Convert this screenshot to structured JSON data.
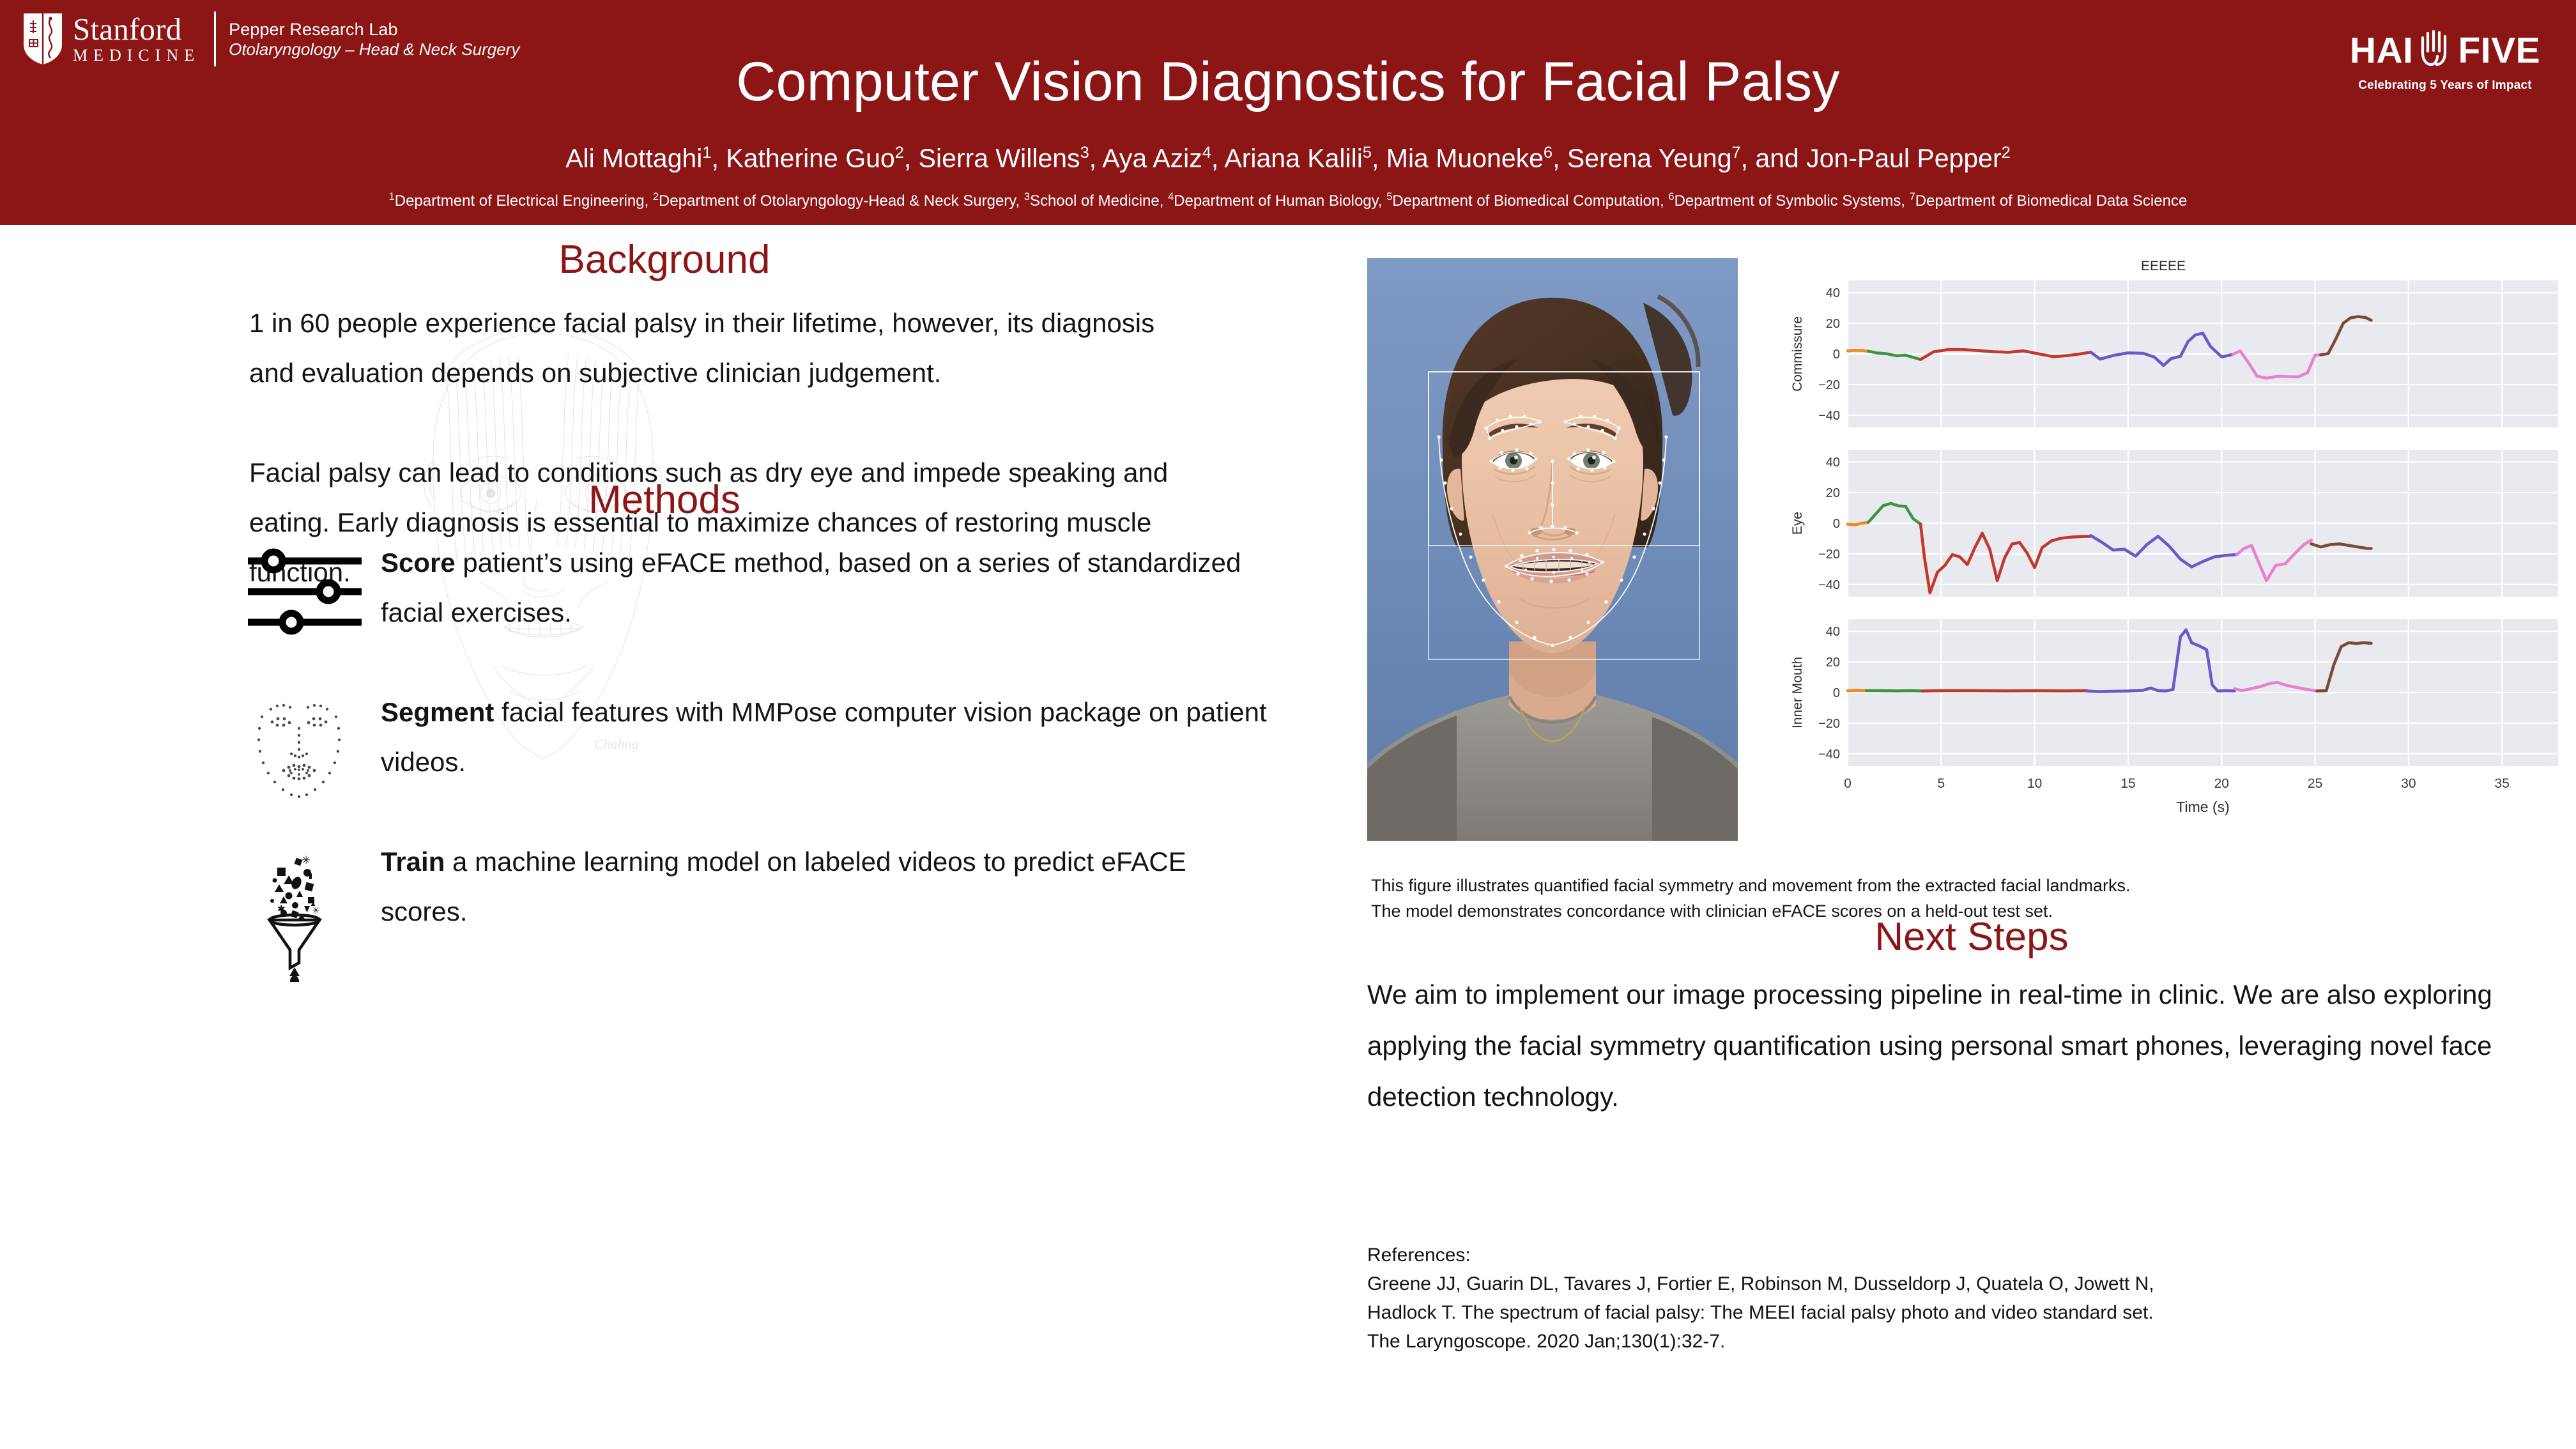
{
  "header": {
    "institution_name": "Stanford",
    "institution_sub": "MEDICINE",
    "lab_name": "Pepper Research Lab",
    "lab_dept": "Otolaryngology – Head & Neck Surgery",
    "title": "Computer Vision Diagnostics for Facial Palsy",
    "authors_html": "Ali Mottaghi<sup>1</sup>, Katherine Guo<sup>2</sup>, Sierra Willens<sup>3</sup>, Aya Aziz<sup>4</sup>, Ariana Kalili<sup>5</sup>, Mia Muoneke<sup>6</sup>, Serena Yeung<sup>7</sup>, and Jon-Paul Pepper<sup>2</sup>",
    "affiliations_html": "<sup>1</sup>Department of Electrical Engineering, <sup>2</sup>Department of Otolaryngology-Head &amp; Neck Surgery, <sup>3</sup>School of Medicine, <sup>4</sup>Department of Human Biology, <sup>5</sup>Department of Biomedical Computation, <sup>6</sup>Department of Symbolic Systems, <sup>7</sup>Department of Biomedical Data Science",
    "sponsor_logo_text": "HAI FIVE",
    "sponsor_logo_part1": "HAI",
    "sponsor_logo_part2": "FIVE",
    "sponsor_tagline": "Celebrating 5 Years of Impact",
    "brand_color": "#8c1515",
    "header_text_color": "#ffffff"
  },
  "background": {
    "heading": "Background",
    "paragraph_1": "1 in 60 people experience facial palsy in their lifetime, however, its diagnosis and evaluation depends on subjective clinician judgement.",
    "paragraph_2": "Facial palsy can lead to conditions such as dry eye and impede speaking and eating. Early diagnosis is essential to maximize chances of restoring muscle function."
  },
  "methods": {
    "heading": "Methods",
    "items": [
      {
        "icon": "sliders-icon",
        "lead": "Score",
        "rest": " patient’s using eFACE method, based on a series of standardized facial exercises."
      },
      {
        "icon": "facial-landmarks-icon",
        "lead": "Segment",
        "rest": " facial features with MMPose computer vision package on patient videos."
      },
      {
        "icon": "funnel-icon",
        "lead": "Train",
        "rest": " a machine learning model on labeled videos to predict eFACE scores."
      }
    ]
  },
  "figure": {
    "photo_alt": "patient-face-with-landmarks",
    "caption_line_1": "This figure illustrates quantified facial symmetry and movement from the extracted facial landmarks.",
    "caption_line_2": "The model demonstrates concordance with clinician eFACE scores on a held-out test set."
  },
  "next_steps": {
    "heading": "Next Steps",
    "paragraph": "We aim to implement our image processing pipeline in real-time in clinic. We are also exploring applying the facial symmetry quantification using personal smart phones, leveraging novel face detection technology."
  },
  "references": {
    "label": "References:",
    "line_1": "Greene JJ, Guarin DL, Tavares J, Fortier E, Robinson M, Dusseldorp J, Quatela O, Jowett N,",
    "line_2": "Hadlock T. The spectrum of facial palsy: The MEEI facial palsy photo and video standard set.",
    "line_3": "The Laryngoscope. 2020 Jan;130(1):32-7."
  },
  "chart_data": [
    {
      "type": "line",
      "title": "EEEEE",
      "ylabel": "Commissure",
      "xlabel": "",
      "xlim": [
        0,
        38
      ],
      "ylim": [
        -48,
        48
      ],
      "yticks": [
        -40,
        -20,
        0,
        20,
        40
      ],
      "xticks": [
        0,
        5,
        10,
        15,
        20,
        25,
        30,
        35
      ],
      "grid": true,
      "legend": "none",
      "series": [
        {
          "name": "segment-orange",
          "color": "#ee8c1f",
          "x": [
            0.0,
            0.4,
            0.8,
            1.1
          ],
          "y": [
            2.0,
            2.4,
            2.2,
            1.8
          ]
        },
        {
          "name": "segment-green",
          "color": "#3f9442",
          "x": [
            1.1,
            1.6,
            2.1,
            2.6,
            3.1,
            3.6,
            3.9
          ],
          "y": [
            1.8,
            0.6,
            0.1,
            -1.2,
            -0.8,
            -2.6,
            -3.6
          ]
        },
        {
          "name": "segment-red",
          "color": "#c2392b",
          "x": [
            3.9,
            4.6,
            5.4,
            6.2,
            7.0,
            7.8,
            8.6,
            9.4,
            10.2,
            11.0,
            11.8,
            12.6,
            13.0
          ],
          "y": [
            -3.6,
            1.4,
            2.9,
            2.8,
            2.2,
            1.4,
            1.1,
            2.0,
            0.1,
            -1.8,
            -1.0,
            0.3,
            1.2
          ]
        },
        {
          "name": "segment-purple",
          "color": "#6b58c9",
          "x": [
            13.0,
            13.5,
            14.2,
            15.0,
            15.8,
            16.4,
            16.9,
            17.3,
            17.8,
            18.2,
            18.6,
            19.0,
            19.4,
            20.0,
            20.6
          ],
          "y": [
            1.2,
            -3.4,
            -1.0,
            0.7,
            0.4,
            -2.0,
            -7.5,
            -3.0,
            -1.6,
            8.0,
            12.5,
            13.5,
            5.0,
            -1.9,
            -0.3
          ]
        },
        {
          "name": "segment-pink",
          "color": "#e87fd0",
          "x": [
            20.6,
            21.0,
            21.4,
            21.9,
            22.4,
            23.0,
            23.6,
            24.1,
            24.6,
            25.0,
            25.3
          ],
          "y": [
            -0.3,
            1.9,
            -5.0,
            -14.5,
            -15.8,
            -14.6,
            -14.8,
            -15.0,
            -12.2,
            -0.8,
            -0.6
          ]
        },
        {
          "name": "segment-brown",
          "color": "#7a4b30",
          "x": [
            25.3,
            25.7,
            26.1,
            26.5,
            26.9,
            27.3,
            27.7,
            28.0
          ],
          "y": [
            -0.6,
            0.2,
            9.5,
            20.0,
            23.6,
            24.4,
            23.8,
            22.0
          ]
        }
      ]
    },
    {
      "type": "line",
      "title": "",
      "ylabel": "Eye",
      "xlabel": "",
      "xlim": [
        0,
        38
      ],
      "ylim": [
        -48,
        48
      ],
      "yticks": [
        -40,
        -20,
        0,
        20,
        40
      ],
      "xticks": [
        0,
        5,
        10,
        15,
        20,
        25,
        30,
        35
      ],
      "grid": true,
      "legend": "none",
      "series": [
        {
          "name": "segment-orange",
          "color": "#ee8c1f",
          "x": [
            0.0,
            0.4,
            0.8,
            1.1
          ],
          "y": [
            -0.6,
            -1.0,
            0.1,
            0.6
          ]
        },
        {
          "name": "segment-green",
          "color": "#3f9442",
          "x": [
            1.1,
            1.5,
            1.9,
            2.3,
            2.7,
            3.1,
            3.5,
            3.9
          ],
          "y": [
            0.6,
            6.0,
            11.5,
            13.0,
            11.4,
            11.0,
            3.0,
            -0.6
          ]
        },
        {
          "name": "segment-red",
          "color": "#c2392b",
          "x": [
            3.9,
            4.1,
            4.4,
            4.8,
            5.2,
            5.6,
            6.0,
            6.4,
            6.8,
            7.2,
            7.6,
            8.0,
            8.4,
            8.8,
            9.2,
            9.6,
            10.0,
            10.4,
            10.9,
            11.4,
            12.0,
            12.6,
            13.0
          ],
          "y": [
            -0.5,
            -22.0,
            -45.5,
            -32.0,
            -27.5,
            -20.5,
            -22.0,
            -27.0,
            -16.0,
            -6.5,
            -17.0,
            -37.5,
            -22.5,
            -13.5,
            -12.6,
            -19.5,
            -29.0,
            -16.0,
            -11.5,
            -9.8,
            -9.0,
            -8.6,
            -8.5
          ]
        },
        {
          "name": "segment-purple",
          "color": "#6b58c9",
          "x": [
            13.0,
            13.6,
            14.2,
            14.8,
            15.4,
            16.0,
            16.6,
            17.2,
            17.8,
            18.4,
            19.0,
            19.6,
            20.2,
            20.8
          ],
          "y": [
            -8.0,
            -12.5,
            -17.5,
            -17.0,
            -21.5,
            -14.0,
            -8.5,
            -15.0,
            -23.5,
            -28.5,
            -25.0,
            -22.0,
            -21.0,
            -20.5
          ]
        },
        {
          "name": "segment-pink",
          "color": "#e87fd0",
          "x": [
            20.8,
            21.2,
            21.6,
            22.0,
            22.4,
            22.9,
            23.4,
            23.9,
            24.4,
            24.8
          ],
          "y": [
            -20.5,
            -16.5,
            -14.5,
            -26.0,
            -37.5,
            -27.5,
            -26.5,
            -20.0,
            -14.0,
            -11.0
          ]
        },
        {
          "name": "segment-brown",
          "color": "#7a4b30",
          "x": [
            24.8,
            25.3,
            25.8,
            26.3,
            26.8,
            27.3,
            27.8,
            28.0
          ],
          "y": [
            -13.5,
            -15.5,
            -14.0,
            -13.5,
            -14.5,
            -15.5,
            -16.5,
            -16.5
          ]
        }
      ]
    },
    {
      "type": "line",
      "title": "",
      "ylabel": "Inner Mouth",
      "xlabel": "Time (s)",
      "xlim": [
        0,
        38
      ],
      "ylim": [
        -48,
        48
      ],
      "yticks": [
        -40,
        -20,
        0,
        20,
        40
      ],
      "xticks": [
        0,
        5,
        10,
        15,
        20,
        25,
        30,
        35
      ],
      "grid": true,
      "legend": "none",
      "series": [
        {
          "name": "segment-orange",
          "color": "#ee8c1f",
          "x": [
            0.0,
            0.5,
            1.0
          ],
          "y": [
            1.2,
            1.4,
            1.3
          ]
        },
        {
          "name": "segment-green",
          "color": "#3f9442",
          "x": [
            1.0,
            1.8,
            2.6,
            3.4,
            4.0
          ],
          "y": [
            1.3,
            1.2,
            1.1,
            1.2,
            1.0
          ]
        },
        {
          "name": "segment-red",
          "color": "#c2392b",
          "x": [
            4.0,
            5.5,
            7.0,
            8.5,
            10.0,
            11.5,
            12.8
          ],
          "y": [
            1.0,
            1.3,
            1.2,
            1.1,
            1.2,
            1.1,
            1.2
          ]
        },
        {
          "name": "segment-purple",
          "color": "#6b58c9",
          "x": [
            12.8,
            13.4,
            14.2,
            15.0,
            15.8,
            16.2,
            16.6,
            17.0,
            17.4,
            17.8,
            18.1,
            18.4,
            18.8,
            19.2,
            19.5,
            19.8,
            20.2,
            20.7
          ],
          "y": [
            1.0,
            0.6,
            0.8,
            1.0,
            1.5,
            3.0,
            1.2,
            1.0,
            2.0,
            36.5,
            41.0,
            32.5,
            30.5,
            28.0,
            5.0,
            1.0,
            1.2,
            1.1
          ]
        },
        {
          "name": "segment-pink",
          "color": "#e87fd0",
          "x": [
            20.7,
            21.1,
            21.6,
            22.1,
            22.6,
            23.0,
            23.5,
            24.0,
            24.5,
            25.1
          ],
          "y": [
            2.4,
            1.3,
            2.6,
            4.0,
            6.0,
            6.6,
            4.6,
            3.4,
            2.2,
            1.0
          ]
        },
        {
          "name": "segment-brown",
          "color": "#7a4b30",
          "x": [
            25.1,
            25.6,
            26.0,
            26.4,
            26.8,
            27.2,
            27.6,
            28.0
          ],
          "y": [
            1.0,
            1.2,
            18.0,
            30.0,
            32.6,
            32.0,
            32.6,
            32.2
          ]
        }
      ]
    }
  ]
}
